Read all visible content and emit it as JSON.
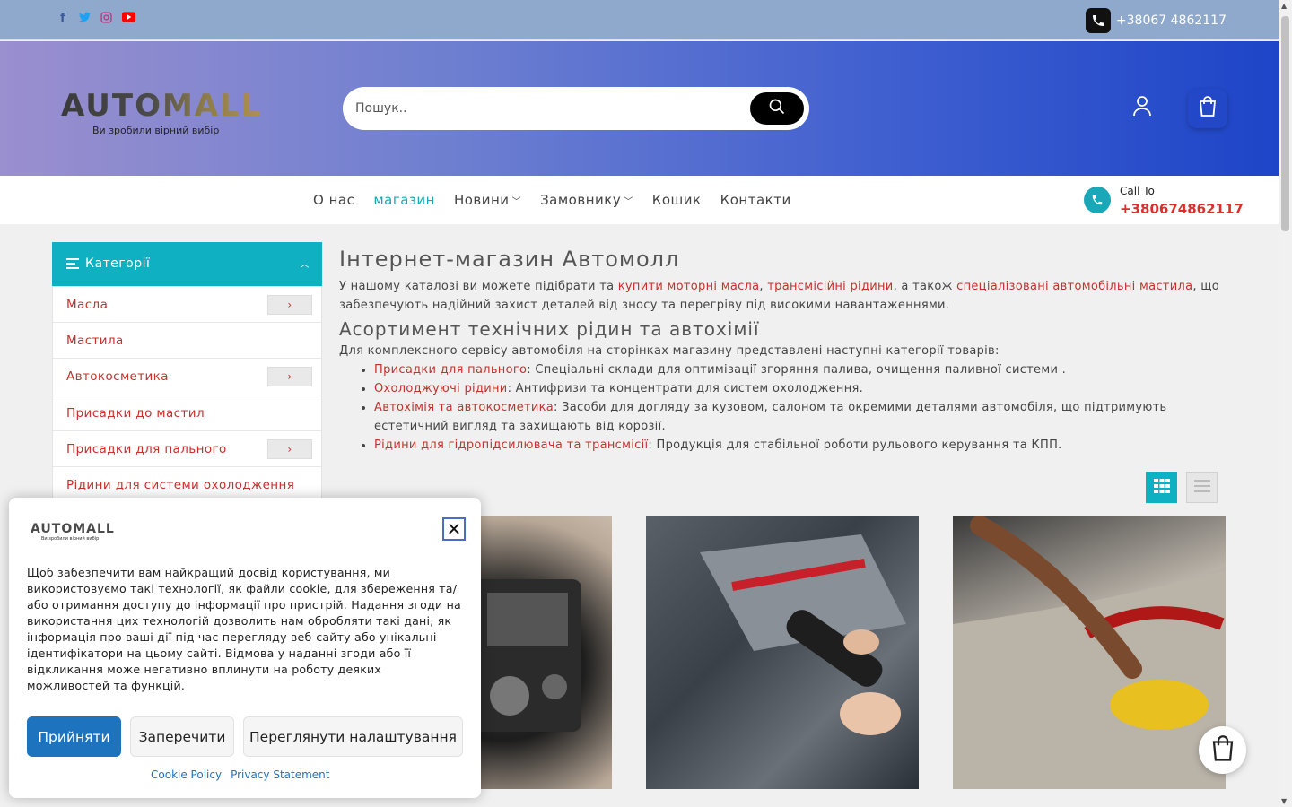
{
  "topbar": {
    "phone": "+38067 4862117",
    "social": [
      {
        "icon": "facebook-icon",
        "glyph": "f",
        "color": "#3b5998"
      },
      {
        "icon": "twitter-icon",
        "glyph": "t",
        "color": "#1da1f2"
      },
      {
        "icon": "instagram-icon",
        "glyph": "◎",
        "color": "#c13584"
      },
      {
        "icon": "youtube-icon",
        "glyph": "▶",
        "color": "#ff0000"
      }
    ]
  },
  "header": {
    "brand": "AUTOMALL",
    "tagline": "Ви зробили вірний вибір",
    "search_placeholder": "Пошук.."
  },
  "nav": {
    "items": [
      {
        "label": "О нас",
        "active": false,
        "dropdown": false
      },
      {
        "label": "магазин",
        "active": true,
        "dropdown": false
      },
      {
        "label": "Новини",
        "active": false,
        "dropdown": true
      },
      {
        "label": "Замовнику",
        "active": false,
        "dropdown": true
      },
      {
        "label": "Кошик",
        "active": false,
        "dropdown": false
      },
      {
        "label": "Контакти",
        "active": false,
        "dropdown": false
      }
    ],
    "call_label": "Call To",
    "call_number": "+380674862117"
  },
  "sidebar": {
    "title": "Категорії",
    "items": [
      {
        "label": "Масла",
        "has_children": true
      },
      {
        "label": "Мастила",
        "has_children": false
      },
      {
        "label": "Автокосметика",
        "has_children": true
      },
      {
        "label": "Присадки до мастил",
        "has_children": false
      },
      {
        "label": "Присадки для пального",
        "has_children": true
      },
      {
        "label": "Рідини для системи охолодження",
        "has_children": false
      }
    ]
  },
  "main": {
    "h1": "Інтернет-магазин Автомолл",
    "intro_1": "У нашому каталозі ви можете підібрати та ",
    "intro_link_1": "купити моторні масла",
    "intro_2": ", ",
    "intro_link_2": "трансмісійні рідини",
    "intro_3": ", а також ",
    "intro_link_3": "спеціалізовані автомобільні мастила",
    "intro_4": ", що забезпечують надійний захист деталей від зносу та перегріву під високими навантаженнями.",
    "h2": "Асортимент технічних рідин та автохімії",
    "lead": "Для комплексного сервісу автомобіля на сторінках магазину представлені наступні категорії товарів:",
    "list": [
      {
        "link": "Присадки для пального",
        "text": ": Спеціальні склади для оптимізації згоряння палива, очищення паливної системи ."
      },
      {
        "link": "Охолоджуючі рідини",
        "text": ": Антифризи та концентрати для систем охолодження."
      },
      {
        "link": "Автохімія та автокосметика",
        "text": ": Засоби для догляду за кузовом, салоном та окремими деталями автомобіля, що підтримують естетичний вигляд та захищають від корозії."
      },
      {
        "link": "Рідини для гідропідсилювача та трансмісії",
        "text": ": Продукція для стабільної роботи рульового керування та КПП."
      }
    ]
  },
  "cookie": {
    "brand": "AUTOMALL",
    "tagline": "Ви зробили вірний вибір",
    "close": "✕",
    "text": "Щоб забезпечити вам найкращий досвід користування, ми використовуємо такі технології, як файли cookie, для збереження та/або отримання доступу до інформації про пристрій. Надання згоди на використання цих технологій дозволить нам обробляти такі дані, як інформація про ваші дії під час перегляду веб-сайту або унікальні ідентифікатори на цьому сайті. Відмова у наданні згоди або її відкликання може негативно вплинути на роботу деяких можливостей та функцій.",
    "accept": "Прийняти",
    "deny": "Заперечити",
    "settings": "Переглянути налаштування",
    "cookie_policy": "Cookie Policy",
    "privacy": "Privacy Statement"
  },
  "colors": {
    "accent": "#0fb0c2",
    "link_red": "#c9302c",
    "primary_blue": "#1e73be"
  }
}
